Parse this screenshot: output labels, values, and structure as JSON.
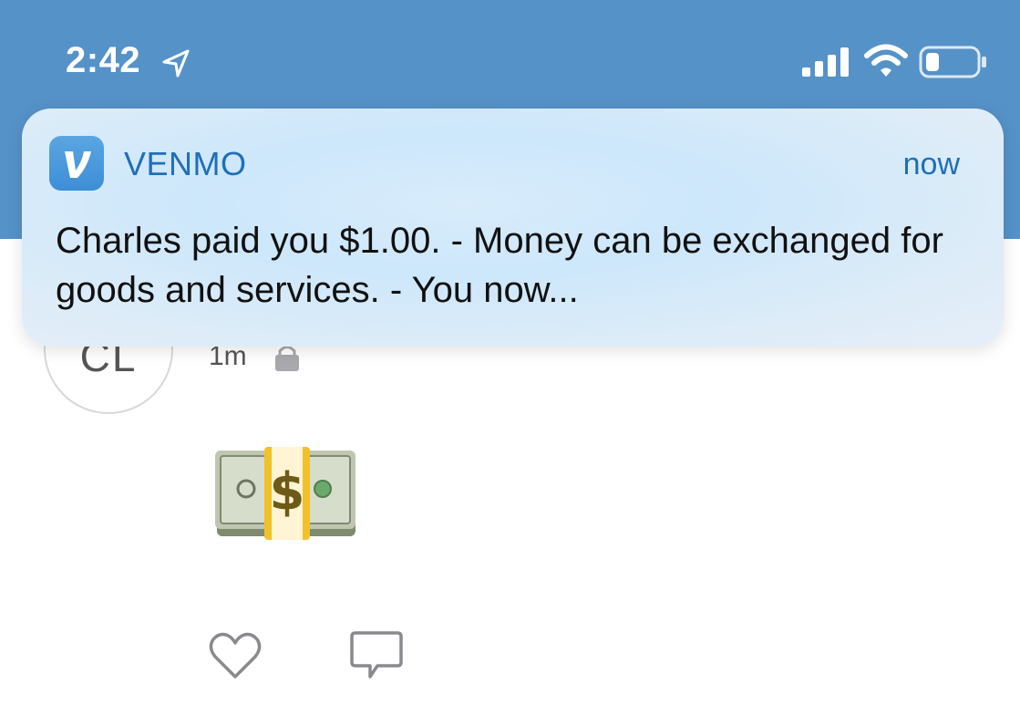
{
  "status_bar": {
    "time": "2:42",
    "icons": [
      "location-arrow-icon",
      "cellular-signal-icon",
      "wifi-icon",
      "battery-icon"
    ]
  },
  "notification": {
    "app_name": "VENMO",
    "app_icon": "venmo-v-icon",
    "time": "now",
    "message": "Charles paid you $1.00. - Money can be exchanged for goods and services. - You now..."
  },
  "feed_item": {
    "avatar_initials": "CL",
    "age": "1m",
    "privacy_icon": "lock-icon",
    "content_emoji": "money-bag-emoji",
    "actions": [
      "heart-icon",
      "comment-icon"
    ]
  },
  "colors": {
    "header_blue": "#5592c8",
    "venmo_blue": "#3d8ed6",
    "link_blue": "#1f6fb8"
  }
}
